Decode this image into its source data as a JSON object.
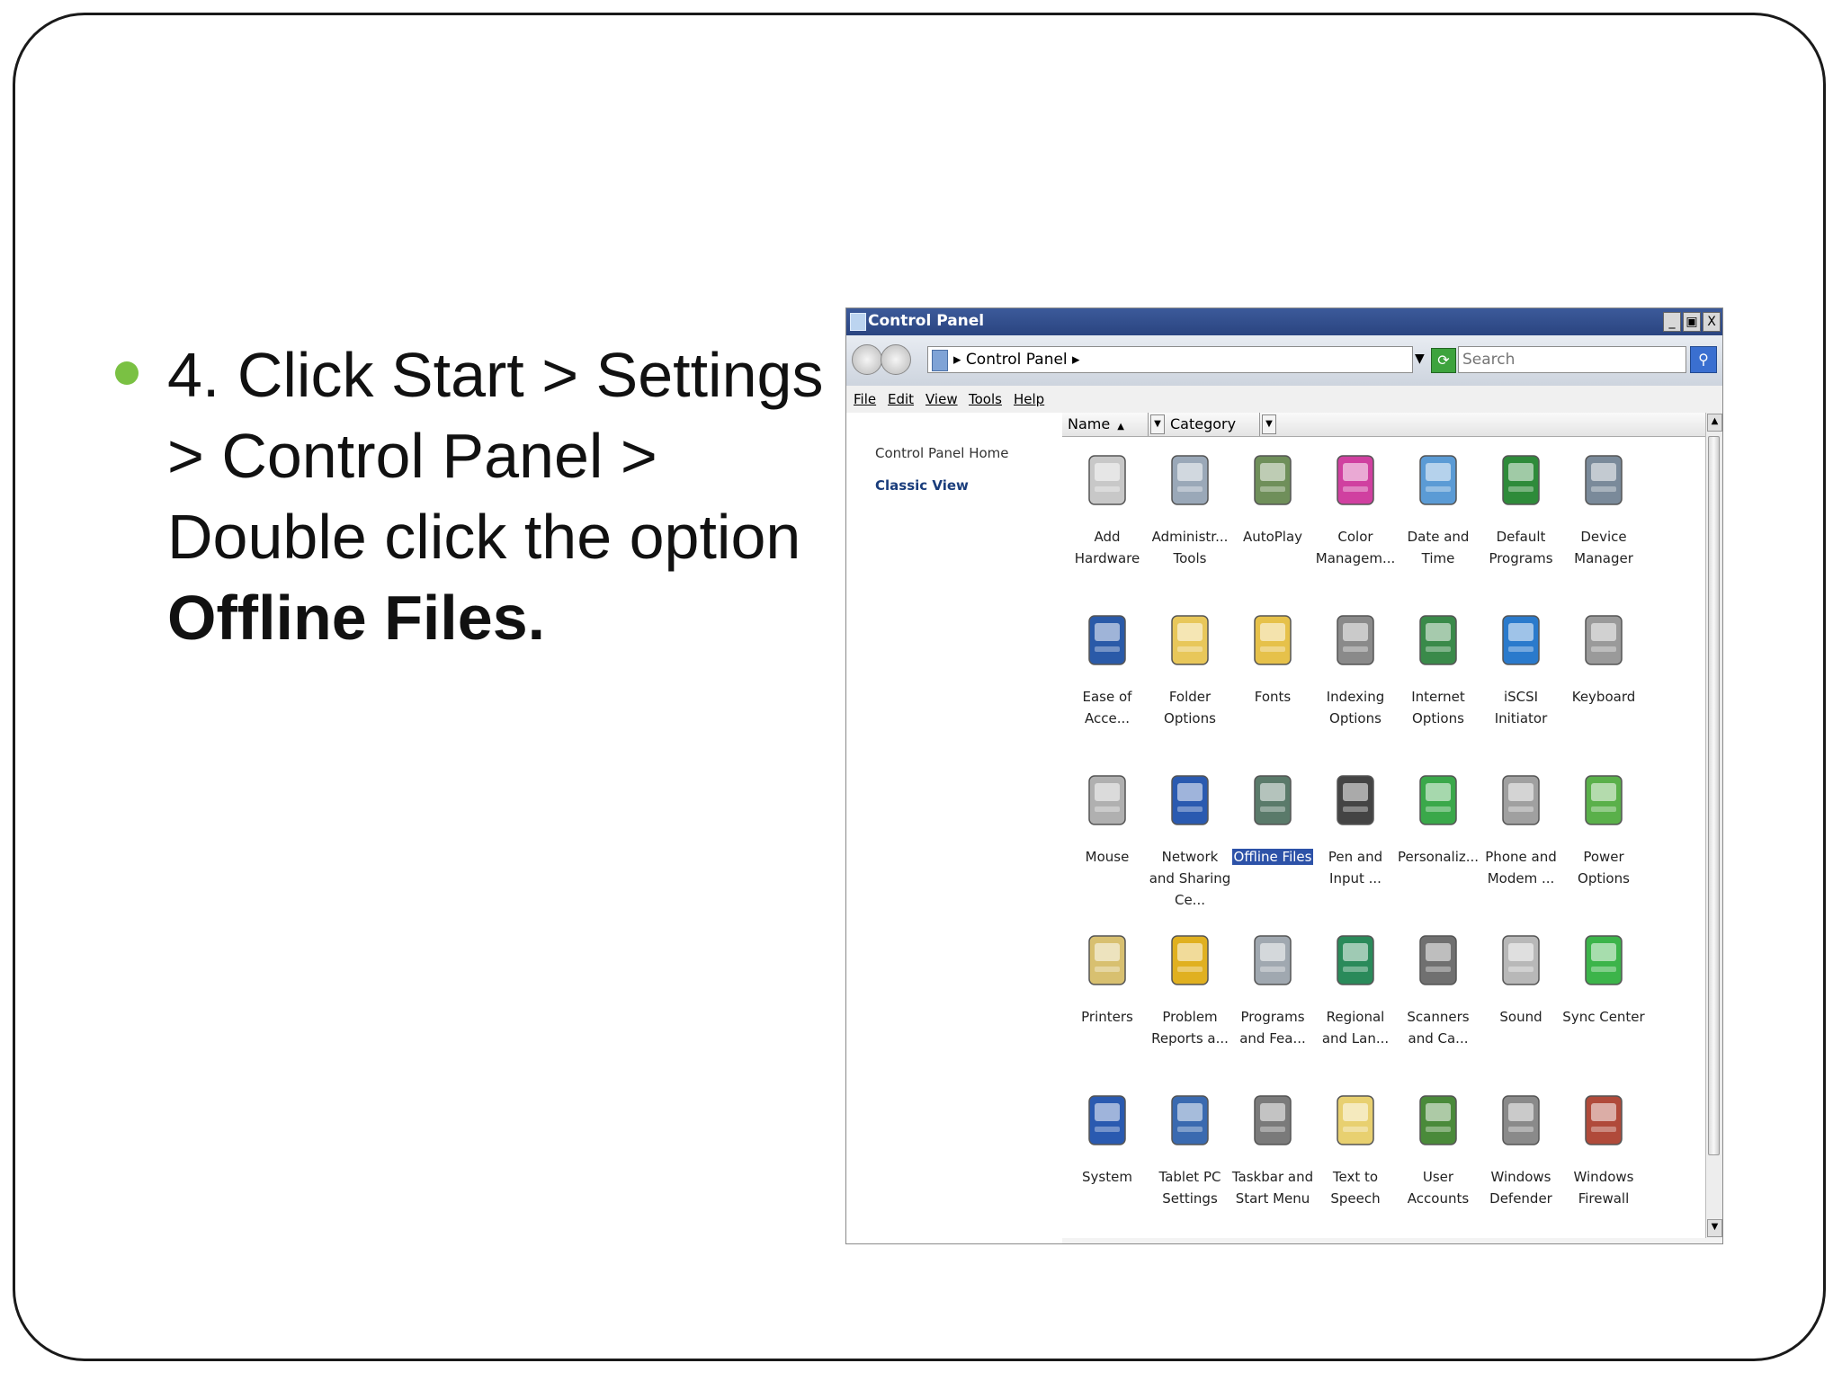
{
  "slide": {
    "bullet_line1": "4. Click Start  > Settings",
    "bullet_line2": "> Control Panel  >",
    "bullet_line3": "Double click the option",
    "bullet_bold": "Offline Files.",
    "bullet_color": "#7ac143"
  },
  "window": {
    "title": "Control Panel",
    "minimize": "_",
    "restore": "и",
    "close": "X",
    "address": "▸ Control Panel ▸",
    "search_placeholder": "Search",
    "refresh_icon": "refresh-icon",
    "menu": [
      "File",
      "Edit",
      "View",
      "Tools",
      "Help"
    ],
    "left_links": [
      "Control Panel Home",
      "Classic View"
    ],
    "columns": [
      "Name",
      "Category"
    ]
  },
  "items": [
    {
      "label": "Add Hardware",
      "icon": "add-hardware-icon",
      "color": "#c8c8c8"
    },
    {
      "label": "Administr... Tools",
      "icon": "admin-tools-icon",
      "color": "#9aa8b8"
    },
    {
      "label": "AutoPlay",
      "icon": "autoplay-icon",
      "color": "#6f8f5a"
    },
    {
      "label": "Color Managem...",
      "icon": "color-management-icon",
      "color": "#d040a0"
    },
    {
      "label": "Date and Time",
      "icon": "date-time-icon",
      "color": "#5b9bd5"
    },
    {
      "label": "Default Programs",
      "icon": "default-programs-icon",
      "color": "#2e8b3a"
    },
    {
      "label": "Device Manager",
      "icon": "device-manager-icon",
      "color": "#7a8a9a"
    },
    {
      "label": "Ease of Acce...",
      "icon": "ease-of-access-icon",
      "color": "#2a5aa8"
    },
    {
      "label": "Folder Options",
      "icon": "folder-options-icon",
      "color": "#e8c75a"
    },
    {
      "label": "Fonts",
      "icon": "fonts-icon",
      "color": "#e6c14a"
    },
    {
      "label": "Indexing Options",
      "icon": "indexing-options-icon",
      "color": "#8a8a8a"
    },
    {
      "label": "Internet Options",
      "icon": "internet-options-icon",
      "color": "#3a8a4a"
    },
    {
      "label": "iSCSI Initiator",
      "icon": "iscsi-initiator-icon",
      "color": "#2a7acc"
    },
    {
      "label": "Keyboard",
      "icon": "keyboard-icon",
      "color": "#9a9a9a"
    },
    {
      "label": "Mouse",
      "icon": "mouse-icon",
      "color": "#b0b0b0"
    },
    {
      "label": "Network and Sharing Ce...",
      "icon": "network-sharing-icon",
      "color": "#2a5ab0"
    },
    {
      "label": "Offline Files",
      "icon": "offline-files-icon",
      "color": "#5a7a6a",
      "selected": true
    },
    {
      "label": "Pen and Input ...",
      "icon": "pen-input-icon",
      "color": "#444444"
    },
    {
      "label": "Personaliz...",
      "icon": "personalization-icon",
      "color": "#3aa84a"
    },
    {
      "label": "Phone and Modem ...",
      "icon": "phone-modem-icon",
      "color": "#a0a0a0"
    },
    {
      "label": "Power Options",
      "icon": "power-options-icon",
      "color": "#5ab04a"
    },
    {
      "label": "Printers",
      "icon": "printers-icon",
      "color": "#d8c070"
    },
    {
      "label": "Problem Reports a...",
      "icon": "problem-reports-icon",
      "color": "#e0b020"
    },
    {
      "label": "Programs and Fea...",
      "icon": "programs-features-icon",
      "color": "#a0a8b0"
    },
    {
      "label": "Regional and Lan...",
      "icon": "regional-language-icon",
      "color": "#2a8a5a"
    },
    {
      "label": "Scanners and Ca...",
      "icon": "scanners-cameras-icon",
      "color": "#707070"
    },
    {
      "label": "Sound",
      "icon": "sound-icon",
      "color": "#b8b8b8"
    },
    {
      "label": "Sync Center",
      "icon": "sync-center-icon",
      "color": "#3cb44a"
    },
    {
      "label": "System",
      "icon": "system-icon",
      "color": "#2a5ab0"
    },
    {
      "label": "Tablet PC Settings",
      "icon": "tablet-pc-icon",
      "color": "#3a6ab0"
    },
    {
      "label": "Taskbar and Start Menu",
      "icon": "taskbar-start-icon",
      "color": "#7a7a7a"
    },
    {
      "label": "Text to Speech",
      "icon": "text-to-speech-icon",
      "color": "#e8d070"
    },
    {
      "label": "User Accounts",
      "icon": "user-accounts-icon",
      "color": "#4a8a3a"
    },
    {
      "label": "Windows Defender",
      "icon": "windows-defender-icon",
      "color": "#8a8a8a"
    },
    {
      "label": "Windows Firewall",
      "icon": "windows-firewall-icon",
      "color": "#b04a3a"
    }
  ]
}
